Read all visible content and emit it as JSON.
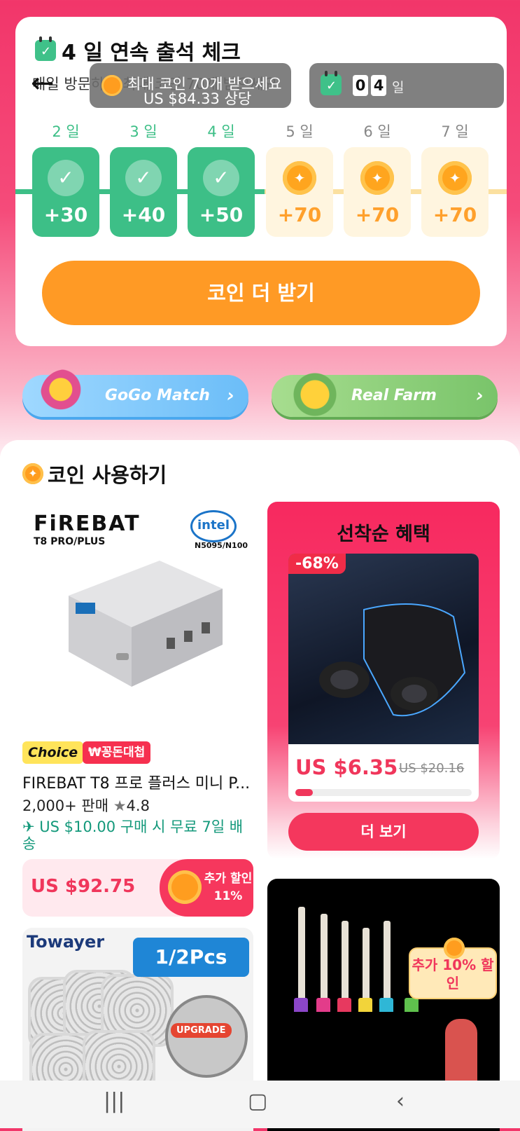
{
  "checkin": {
    "title": "4 일 연속 출석 체크",
    "subtitle": "매일 방문하고 최대 코인 70개 받으세요",
    "overlay_line1": "최대 코인 70개 받으세요",
    "overlay_line2": "US $84.33 상당",
    "streak_digits": [
      "0",
      "4"
    ],
    "streak_unit": "일",
    "days": [
      {
        "label": "2 일",
        "reward": "+30",
        "done": true
      },
      {
        "label": "3 일",
        "reward": "+40",
        "done": true
      },
      {
        "label": "4 일",
        "reward": "+50",
        "done": true
      },
      {
        "label": "5 일",
        "reward": "+70",
        "done": false
      },
      {
        "label": "6 일",
        "reward": "+70",
        "done": false
      },
      {
        "label": "7 일",
        "reward": "+70",
        "done": false
      }
    ],
    "cta_label": "코인 더 받기"
  },
  "games": [
    {
      "label": "GoGo Match"
    },
    {
      "label": "Real Farm"
    }
  ],
  "coin_section": {
    "title": "코인 사용하기"
  },
  "product1": {
    "brand": "FiREBAT",
    "brand_sub": "T8 PRO/PLUS",
    "intel_label": "intel",
    "intel_sub": "N5095/N100",
    "badge_choice": "Choice",
    "badge_promo": "₩꽁돈대첩",
    "title": "FIREBAT T8 프로 플러스 미니 P...",
    "sold": "2,000+ 판매",
    "rating": "4.8",
    "shipping": "US $10.00 구매 시 무료 7일 배송",
    "price": "US $92.75",
    "extra_discount": "추가 할인 11%"
  },
  "product2": {
    "brand": "Towayer",
    "ribbon": "1/2Pcs",
    "upgrade": "UPGRADE"
  },
  "deal": {
    "title": "선착순 혜택",
    "discount": "-68%",
    "price": "US $6.35",
    "old_price": "US $20.16",
    "progress": 0.1,
    "more_label": "더 보기"
  },
  "product3": {
    "extra_discount": "추가 10% 할인"
  },
  "colors": {
    "accent": "#f0365b",
    "green": "#3dbf87",
    "orange": "#ff9a25"
  }
}
